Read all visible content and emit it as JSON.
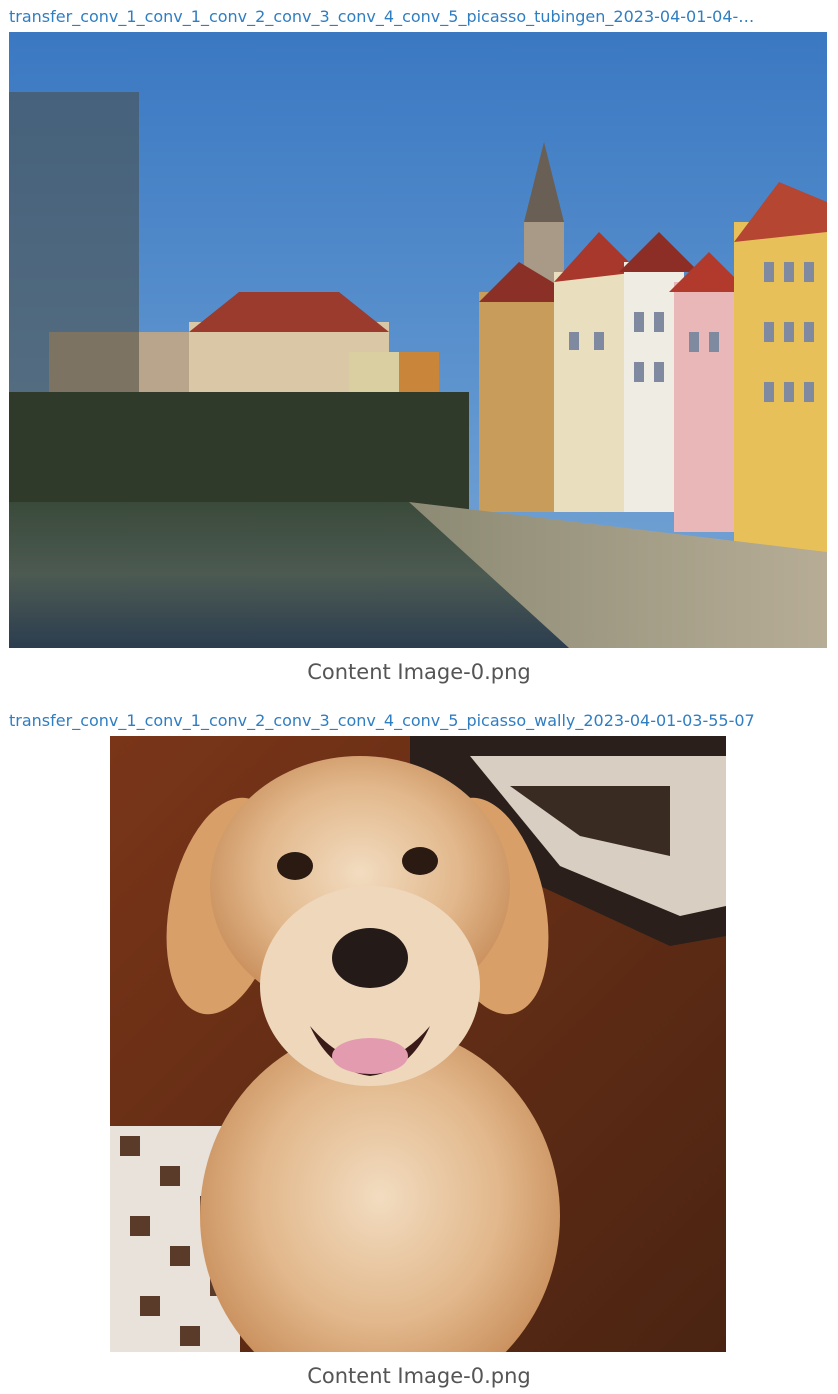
{
  "panels": [
    {
      "run_name": "transfer_conv_1_conv_1_conv_2_conv_3_conv_4_conv_5_picasso_tubingen_2023-04-01-04-…",
      "image": "tubingen-riverside-town-photo",
      "caption": "Content Image-0.png"
    },
    {
      "run_name": "transfer_conv_1_conv_1_conv_2_conv_3_conv_4_conv_5_picasso_wally_2023-04-01-03-55-07",
      "image": "golden-retriever-dog-photo",
      "caption": "Content Image-0.png"
    }
  ],
  "colors": {
    "link": "#2f7ec2",
    "caption": "#555555"
  }
}
